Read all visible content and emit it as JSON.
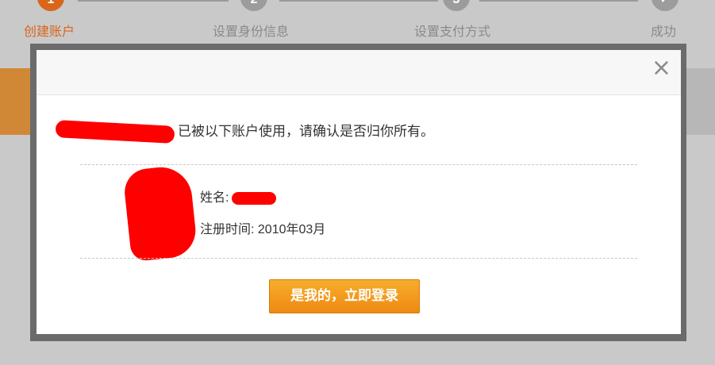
{
  "steps": [
    {
      "number": "1",
      "label": "创建账户",
      "state": "active"
    },
    {
      "number": "2",
      "label": "设置身份信息",
      "state": "todo"
    },
    {
      "number": "3",
      "label": "设置支付方式",
      "state": "todo"
    },
    {
      "number": "✓",
      "label": "成功",
      "state": "todo"
    }
  ],
  "modal": {
    "close_symbol": "×",
    "message_suffix": "已被以下账户使用，请确认是否归你所有。",
    "account": {
      "name_label": "姓名:",
      "register_label": "注册时间:",
      "register_value": "2010年03月"
    },
    "confirm_button": "是我的，立即登录"
  },
  "colors": {
    "accent": "#d9661b",
    "button": "#f29b1e",
    "redaction": "#ff0000"
  }
}
